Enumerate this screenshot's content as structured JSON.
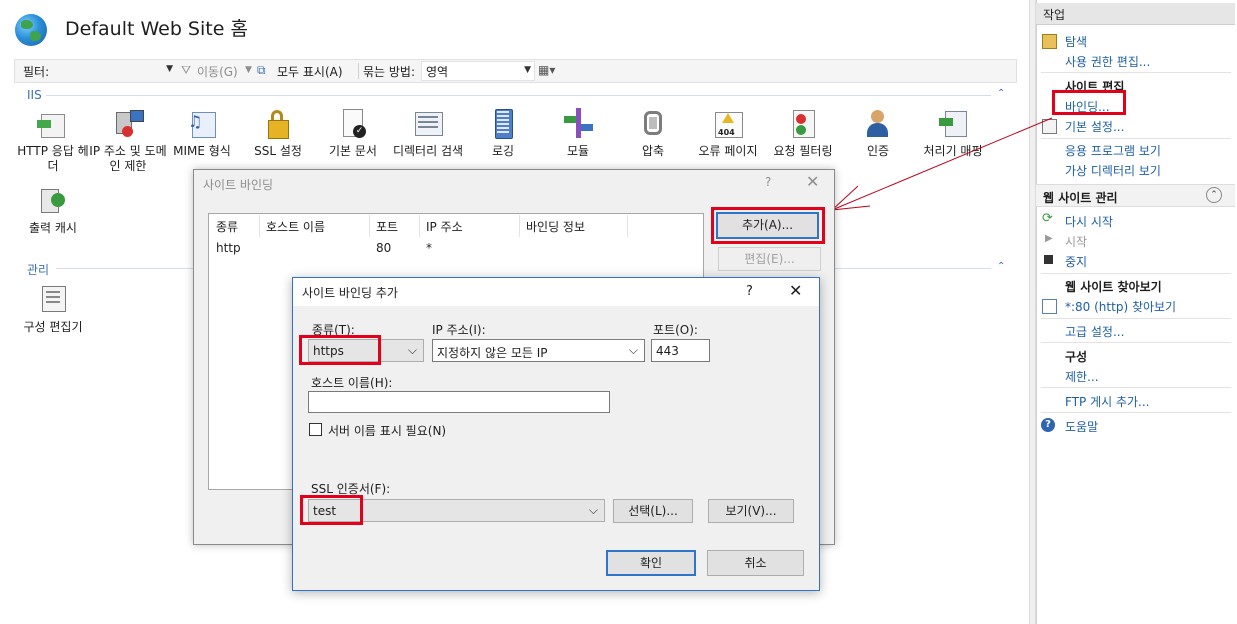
{
  "header": {
    "title": "Default Web Site 홈"
  },
  "toolbar": {
    "filter_label": "필터:",
    "go_label": "이동(G)",
    "show_all_label": "모두 표시(A)",
    "group_by_label": "묶는 방법:",
    "group_by_value": "영역"
  },
  "groups": {
    "iis": "IIS",
    "management": "관리"
  },
  "features": {
    "http_response": "HTTP 응답 헤더",
    "ip_domain": "IP 주소 및 도메인 제한",
    "mime": "MIME 형식",
    "ssl": "SSL 설정",
    "default_doc": "기본 문서",
    "dir_browse": "디렉터리 검색",
    "logging": "로깅",
    "modules": "모듈",
    "compression": "압축",
    "error_pages": "오류 페이지",
    "request_filter": "요청 필터링",
    "auth": "인증",
    "handler": "처리기 매핑",
    "output_cache": "출력 캐시",
    "config_editor": "구성 편집기"
  },
  "actions": {
    "header": "작업",
    "explore": "탐색",
    "edit_permissions": "사용 권한 편집...",
    "edit_site_head": "사이트 편집",
    "bindings": "바인딩...",
    "basic_settings": "기본 설정...",
    "view_apps": "응용 프로그램 보기",
    "view_vdirs": "가상 디렉터리 보기",
    "manage_site_head": "웹 사이트 관리",
    "restart": "다시 시작",
    "start": "시작",
    "stop": "중지",
    "browse_head": "웹 사이트 찾아보기",
    "browse_80": "*:80 (http) 찾아보기",
    "advanced": "고급 설정...",
    "config_head": "구성",
    "limits": "제한...",
    "ftp_publish": "FTP 게시 추가...",
    "help": "도움말"
  },
  "site_bindings_dialog": {
    "title": "사이트 바인딩",
    "help_glyph": "?",
    "close_glyph": "✕",
    "columns": [
      "종류",
      "호스트 이름",
      "포트",
      "IP 주소",
      "바인딩 정보"
    ],
    "rows": [
      {
        "type": "http",
        "host": "",
        "port": "80",
        "ip": "*",
        "info": ""
      }
    ],
    "add_button": "추가(A)...",
    "edit_button": "편집(E)..."
  },
  "add_binding_dialog": {
    "title": "사이트 바인딩 추가",
    "help_glyph": "?",
    "close_glyph": "✕",
    "type_label": "종류(T):",
    "type_value": "https",
    "ip_label": "IP 주소(I):",
    "ip_value": "지정하지 않은 모든 IP",
    "port_label": "포트(O):",
    "port_value": "443",
    "host_label": "호스트 이름(H):",
    "host_value": "",
    "sni_label": "서버 이름 표시 필요(N)",
    "ssl_label": "SSL 인증서(F):",
    "ssl_value": "test",
    "select_button": "선택(L)...",
    "view_button": "보기(V)...",
    "ok_button": "확인",
    "cancel_button": "취소"
  },
  "colors": {
    "link": "#1f5fa5",
    "highlight": "#e2001a",
    "accent": "#2f74c9"
  }
}
